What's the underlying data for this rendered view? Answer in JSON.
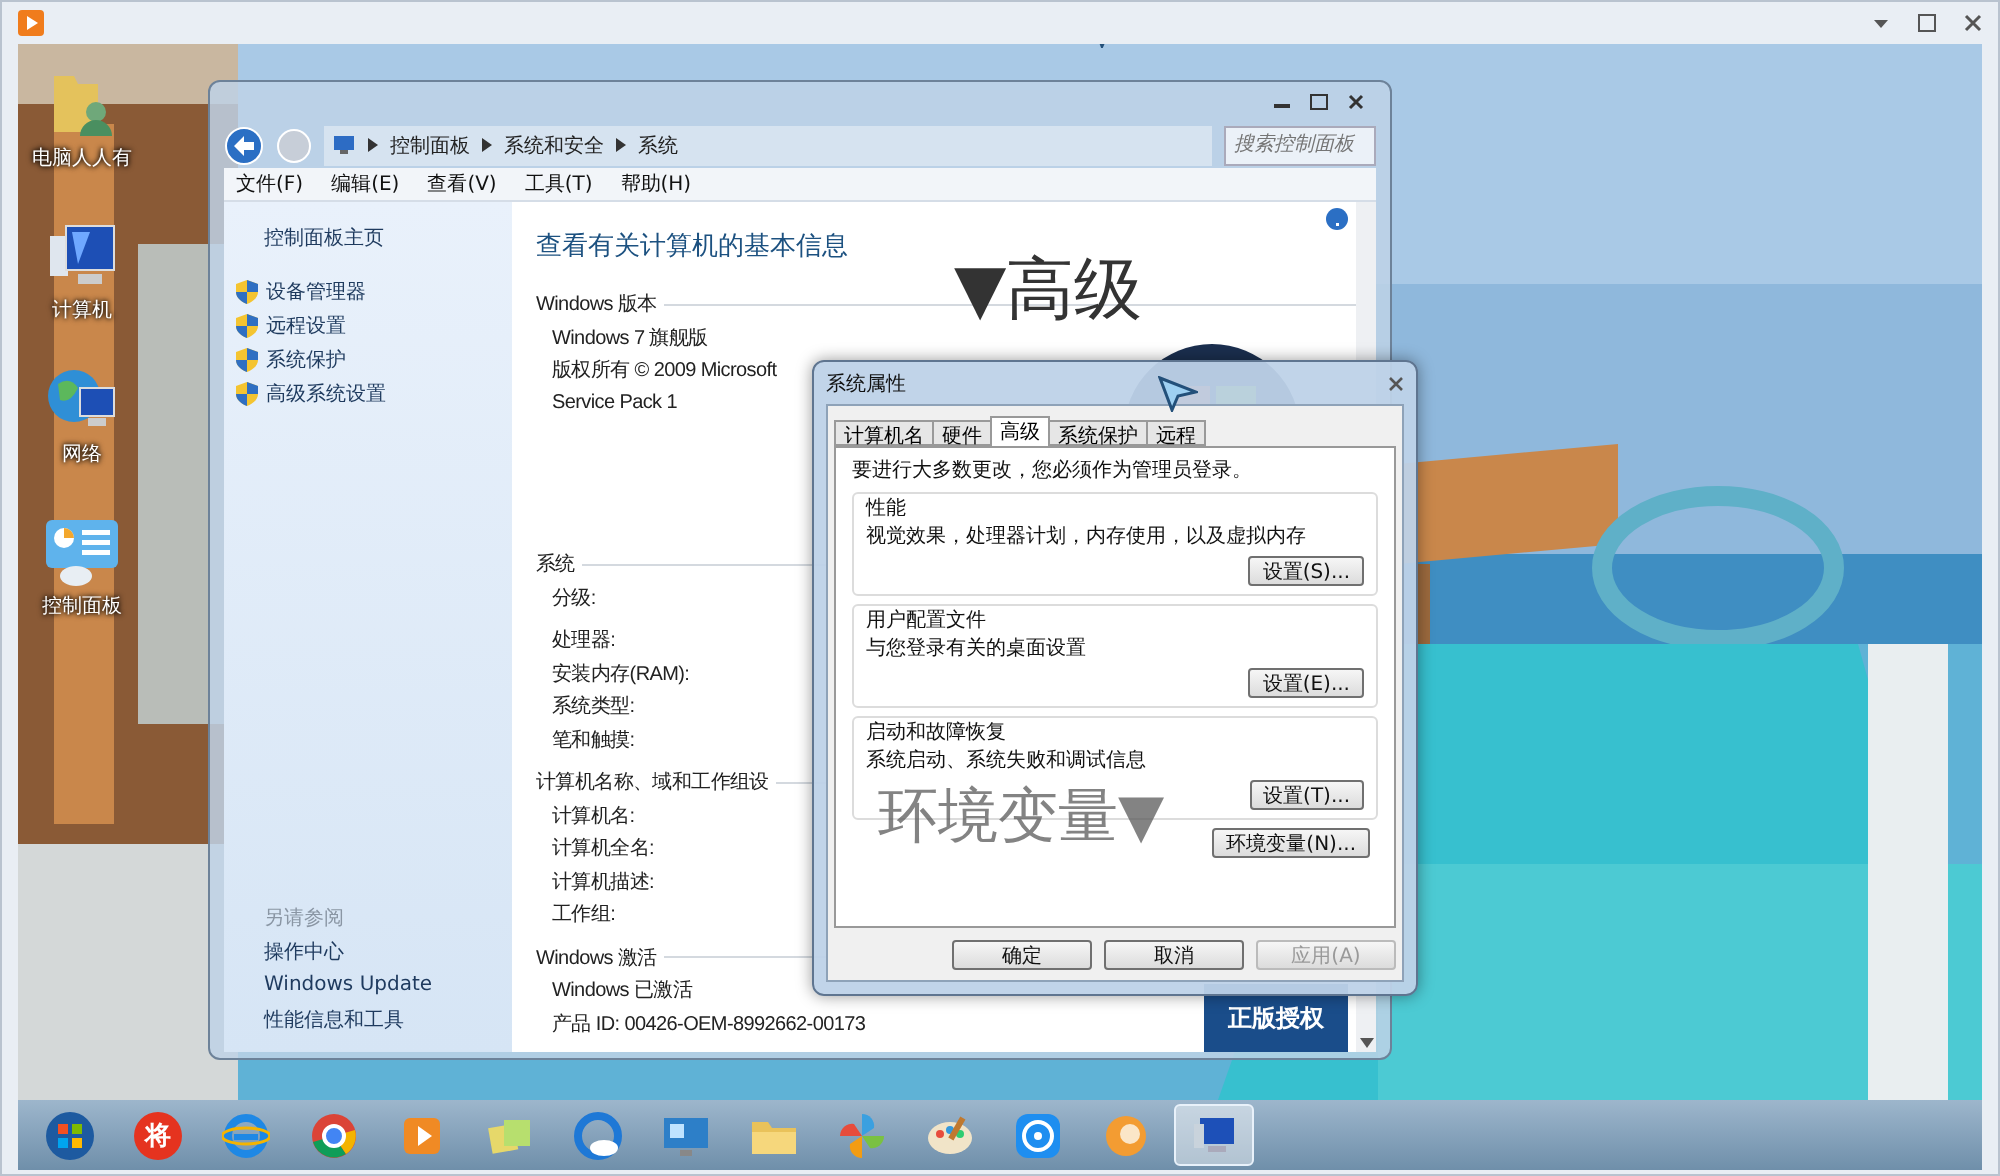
{
  "desktop": {
    "icons": [
      {
        "label": "电脑人人有"
      },
      {
        "label": "计算机"
      },
      {
        "label": "网络"
      },
      {
        "label": "控制面板"
      }
    ]
  },
  "control_panel": {
    "breadcrumb": [
      "控制面板",
      "系统和安全",
      "系统"
    ],
    "search": {
      "placeholder": "搜索控制面板"
    },
    "menu": [
      "文件(F)",
      "编辑(E)",
      "查看(V)",
      "工具(T)",
      "帮助(H)"
    ],
    "sidebar": {
      "home": "控制面板主页",
      "links": [
        "设备管理器",
        "远程设置",
        "系统保护",
        "高级系统设置"
      ],
      "see_also_title": "另请参阅",
      "see_also": [
        "操作中心",
        "Windows Update",
        "性能信息和工具"
      ]
    },
    "heading": "查看有关计算机的基本信息",
    "sections": [
      {
        "title": "Windows 版本",
        "rows": [
          "Windows 7 旗舰版",
          "版权所有 © 2009 Microsoft",
          "Service Pack 1"
        ]
      },
      {
        "title": "系统",
        "rows": [
          "分级:",
          "处理器:",
          "安装内存(RAM):",
          "系统类型:",
          "笔和触摸:"
        ]
      },
      {
        "title": "计算机名称、域和工作组设",
        "rows": [
          "计算机名:",
          "计算机全名:",
          "计算机描述:",
          "工作组:"
        ]
      },
      {
        "title": "Windows 激活",
        "rows": [
          "Windows 已激活",
          "产品 ID: 00426-OEM-8992662-00173"
        ]
      }
    ],
    "genuine_badge": "正版授权"
  },
  "dialog": {
    "title": "系统属性",
    "tabs": [
      {
        "label": "计算机名",
        "selected": false
      },
      {
        "label": "硬件",
        "selected": false
      },
      {
        "label": "高级",
        "selected": true
      },
      {
        "label": "系统保护",
        "selected": false
      },
      {
        "label": "远程",
        "selected": false
      }
    ],
    "notice": "要进行大多数更改，您必须作为管理员登录。",
    "groups": [
      {
        "title": "性能",
        "text": "视觉效果，处理器计划，内存使用，以及虚拟内存",
        "button": "设置(S)..."
      },
      {
        "title": "用户配置文件",
        "text": "与您登录有关的桌面设置",
        "button": "设置(E)..."
      },
      {
        "title": "启动和故障恢复",
        "text": "系统启动、系统失败和调试信息",
        "button": "设置(T)..."
      }
    ],
    "env_button": "环境变量(N)...",
    "buttons": [
      {
        "label": "确定",
        "disabled": false
      },
      {
        "label": "取消",
        "disabled": false
      },
      {
        "label": "应用(A)",
        "disabled": true
      }
    ]
  },
  "annotations": [
    {
      "text": "▼高级"
    },
    {
      "text": "环境变量▼"
    }
  ],
  "taskbar": {
    "items": [
      {
        "selected": false
      },
      {
        "selected": false,
        "label": "将"
      },
      {
        "selected": false
      },
      {
        "selected": false
      },
      {
        "selected": false
      },
      {
        "selected": false
      },
      {
        "selected": false
      },
      {
        "selected": false
      },
      {
        "selected": false
      },
      {
        "selected": false
      },
      {
        "selected": false
      },
      {
        "selected": false
      },
      {
        "selected": false
      },
      {
        "selected": true
      }
    ]
  }
}
